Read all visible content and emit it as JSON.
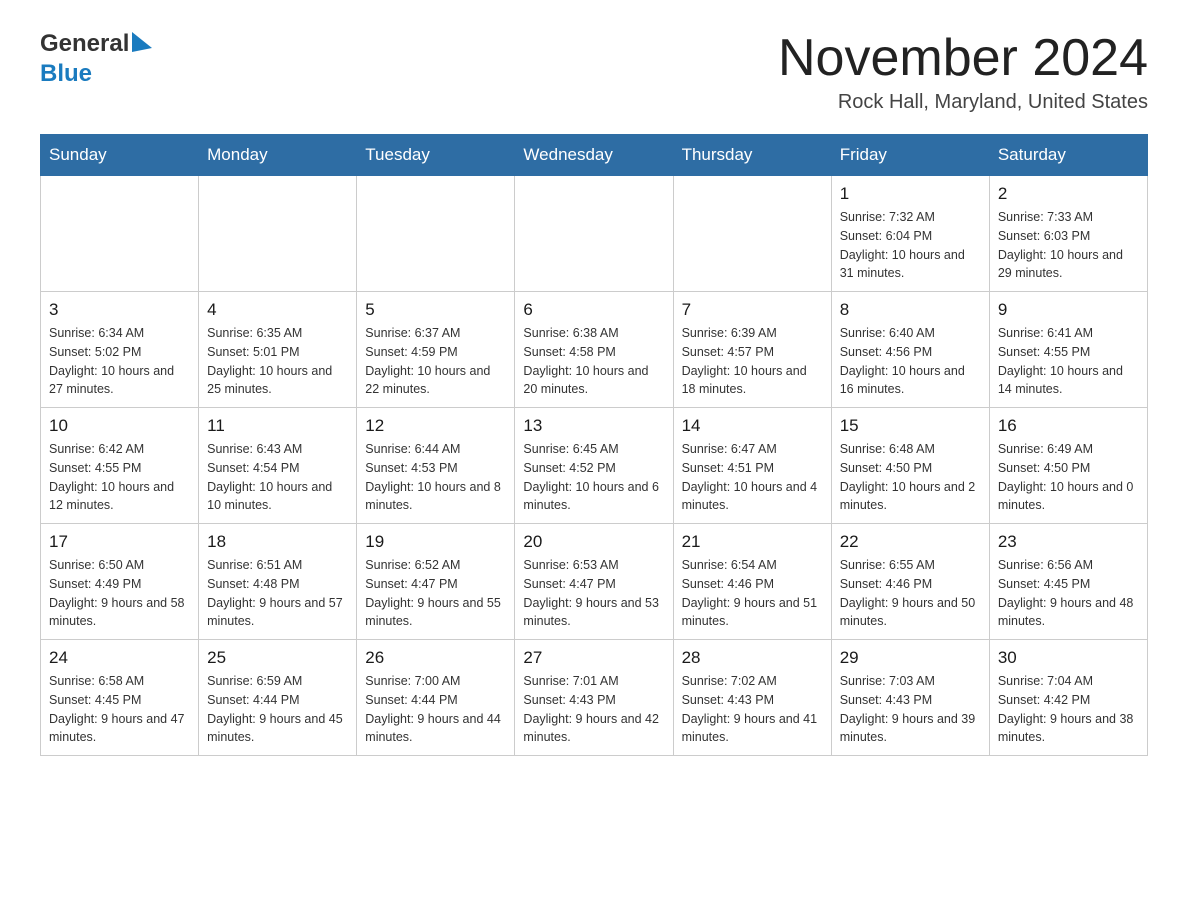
{
  "header": {
    "logo_general": "General",
    "logo_blue": "Blue",
    "month_title": "November 2024",
    "location": "Rock Hall, Maryland, United States"
  },
  "days_of_week": [
    "Sunday",
    "Monday",
    "Tuesday",
    "Wednesday",
    "Thursday",
    "Friday",
    "Saturday"
  ],
  "weeks": [
    [
      {
        "day": "",
        "sunrise": "",
        "sunset": "",
        "daylight": ""
      },
      {
        "day": "",
        "sunrise": "",
        "sunset": "",
        "daylight": ""
      },
      {
        "day": "",
        "sunrise": "",
        "sunset": "",
        "daylight": ""
      },
      {
        "day": "",
        "sunrise": "",
        "sunset": "",
        "daylight": ""
      },
      {
        "day": "",
        "sunrise": "",
        "sunset": "",
        "daylight": ""
      },
      {
        "day": "1",
        "sunrise": "Sunrise: 7:32 AM",
        "sunset": "Sunset: 6:04 PM",
        "daylight": "Daylight: 10 hours and 31 minutes."
      },
      {
        "day": "2",
        "sunrise": "Sunrise: 7:33 AM",
        "sunset": "Sunset: 6:03 PM",
        "daylight": "Daylight: 10 hours and 29 minutes."
      }
    ],
    [
      {
        "day": "3",
        "sunrise": "Sunrise: 6:34 AM",
        "sunset": "Sunset: 5:02 PM",
        "daylight": "Daylight: 10 hours and 27 minutes."
      },
      {
        "day": "4",
        "sunrise": "Sunrise: 6:35 AM",
        "sunset": "Sunset: 5:01 PM",
        "daylight": "Daylight: 10 hours and 25 minutes."
      },
      {
        "day": "5",
        "sunrise": "Sunrise: 6:37 AM",
        "sunset": "Sunset: 4:59 PM",
        "daylight": "Daylight: 10 hours and 22 minutes."
      },
      {
        "day": "6",
        "sunrise": "Sunrise: 6:38 AM",
        "sunset": "Sunset: 4:58 PM",
        "daylight": "Daylight: 10 hours and 20 minutes."
      },
      {
        "day": "7",
        "sunrise": "Sunrise: 6:39 AM",
        "sunset": "Sunset: 4:57 PM",
        "daylight": "Daylight: 10 hours and 18 minutes."
      },
      {
        "day": "8",
        "sunrise": "Sunrise: 6:40 AM",
        "sunset": "Sunset: 4:56 PM",
        "daylight": "Daylight: 10 hours and 16 minutes."
      },
      {
        "day": "9",
        "sunrise": "Sunrise: 6:41 AM",
        "sunset": "Sunset: 4:55 PM",
        "daylight": "Daylight: 10 hours and 14 minutes."
      }
    ],
    [
      {
        "day": "10",
        "sunrise": "Sunrise: 6:42 AM",
        "sunset": "Sunset: 4:55 PM",
        "daylight": "Daylight: 10 hours and 12 minutes."
      },
      {
        "day": "11",
        "sunrise": "Sunrise: 6:43 AM",
        "sunset": "Sunset: 4:54 PM",
        "daylight": "Daylight: 10 hours and 10 minutes."
      },
      {
        "day": "12",
        "sunrise": "Sunrise: 6:44 AM",
        "sunset": "Sunset: 4:53 PM",
        "daylight": "Daylight: 10 hours and 8 minutes."
      },
      {
        "day": "13",
        "sunrise": "Sunrise: 6:45 AM",
        "sunset": "Sunset: 4:52 PM",
        "daylight": "Daylight: 10 hours and 6 minutes."
      },
      {
        "day": "14",
        "sunrise": "Sunrise: 6:47 AM",
        "sunset": "Sunset: 4:51 PM",
        "daylight": "Daylight: 10 hours and 4 minutes."
      },
      {
        "day": "15",
        "sunrise": "Sunrise: 6:48 AM",
        "sunset": "Sunset: 4:50 PM",
        "daylight": "Daylight: 10 hours and 2 minutes."
      },
      {
        "day": "16",
        "sunrise": "Sunrise: 6:49 AM",
        "sunset": "Sunset: 4:50 PM",
        "daylight": "Daylight: 10 hours and 0 minutes."
      }
    ],
    [
      {
        "day": "17",
        "sunrise": "Sunrise: 6:50 AM",
        "sunset": "Sunset: 4:49 PM",
        "daylight": "Daylight: 9 hours and 58 minutes."
      },
      {
        "day": "18",
        "sunrise": "Sunrise: 6:51 AM",
        "sunset": "Sunset: 4:48 PM",
        "daylight": "Daylight: 9 hours and 57 minutes."
      },
      {
        "day": "19",
        "sunrise": "Sunrise: 6:52 AM",
        "sunset": "Sunset: 4:47 PM",
        "daylight": "Daylight: 9 hours and 55 minutes."
      },
      {
        "day": "20",
        "sunrise": "Sunrise: 6:53 AM",
        "sunset": "Sunset: 4:47 PM",
        "daylight": "Daylight: 9 hours and 53 minutes."
      },
      {
        "day": "21",
        "sunrise": "Sunrise: 6:54 AM",
        "sunset": "Sunset: 4:46 PM",
        "daylight": "Daylight: 9 hours and 51 minutes."
      },
      {
        "day": "22",
        "sunrise": "Sunrise: 6:55 AM",
        "sunset": "Sunset: 4:46 PM",
        "daylight": "Daylight: 9 hours and 50 minutes."
      },
      {
        "day": "23",
        "sunrise": "Sunrise: 6:56 AM",
        "sunset": "Sunset: 4:45 PM",
        "daylight": "Daylight: 9 hours and 48 minutes."
      }
    ],
    [
      {
        "day": "24",
        "sunrise": "Sunrise: 6:58 AM",
        "sunset": "Sunset: 4:45 PM",
        "daylight": "Daylight: 9 hours and 47 minutes."
      },
      {
        "day": "25",
        "sunrise": "Sunrise: 6:59 AM",
        "sunset": "Sunset: 4:44 PM",
        "daylight": "Daylight: 9 hours and 45 minutes."
      },
      {
        "day": "26",
        "sunrise": "Sunrise: 7:00 AM",
        "sunset": "Sunset: 4:44 PM",
        "daylight": "Daylight: 9 hours and 44 minutes."
      },
      {
        "day": "27",
        "sunrise": "Sunrise: 7:01 AM",
        "sunset": "Sunset: 4:43 PM",
        "daylight": "Daylight: 9 hours and 42 minutes."
      },
      {
        "day": "28",
        "sunrise": "Sunrise: 7:02 AM",
        "sunset": "Sunset: 4:43 PM",
        "daylight": "Daylight: 9 hours and 41 minutes."
      },
      {
        "day": "29",
        "sunrise": "Sunrise: 7:03 AM",
        "sunset": "Sunset: 4:43 PM",
        "daylight": "Daylight: 9 hours and 39 minutes."
      },
      {
        "day": "30",
        "sunrise": "Sunrise: 7:04 AM",
        "sunset": "Sunset: 4:42 PM",
        "daylight": "Daylight: 9 hours and 38 minutes."
      }
    ]
  ]
}
